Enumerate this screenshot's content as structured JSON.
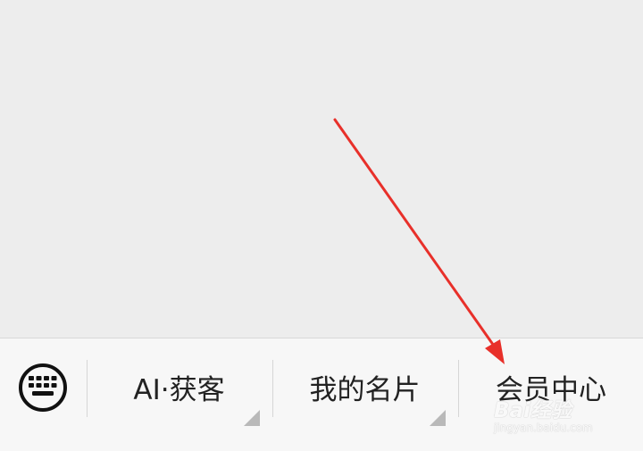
{
  "menu": {
    "keyboard_icon": "keyboard-icon",
    "items": [
      {
        "label": "AI·获客",
        "has_submenu": true
      },
      {
        "label": "我的名片",
        "has_submenu": true
      },
      {
        "label": "会员中心",
        "has_submenu": false
      }
    ]
  },
  "annotation": {
    "color": "#e8302a"
  },
  "watermark": {
    "brand": "Bai经验",
    "url": "jingyan.baidu.com"
  }
}
